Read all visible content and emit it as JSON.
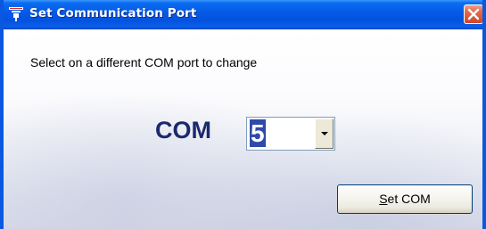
{
  "window": {
    "title": "Set Communication Port",
    "icon": "port-icon",
    "close_icon": "close-icon"
  },
  "content": {
    "instruction": "Select on a different COM port to change",
    "com_label": "COM",
    "com_port_value": "5"
  },
  "set_button": {
    "mnemonic": "S",
    "label_rest": "et COM"
  },
  "colors": {
    "titlebar": "#0558e6",
    "com_label": "#1a2a6c",
    "selection": "#2f4aa8"
  }
}
